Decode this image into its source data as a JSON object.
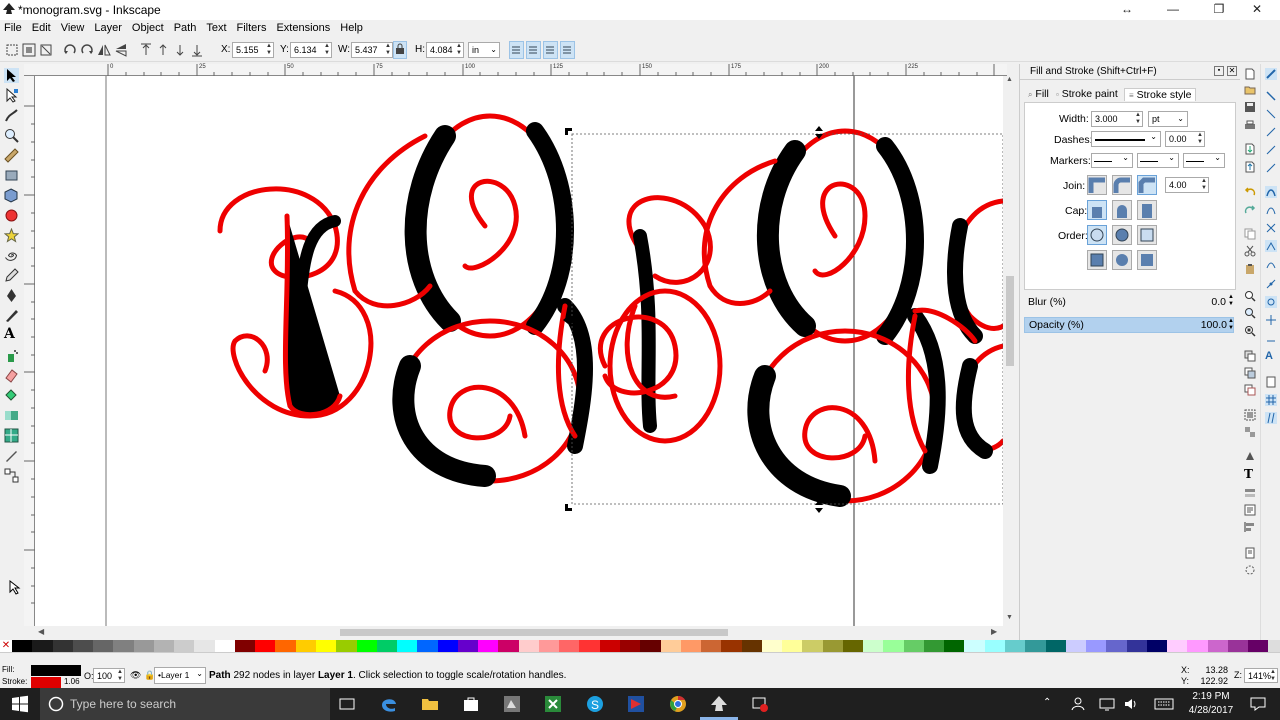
{
  "window": {
    "title": "*monogram.svg - Inkscape",
    "controls": [
      "↔",
      "—",
      "❐",
      "✕"
    ]
  },
  "menu": [
    "File",
    "Edit",
    "View",
    "Layer",
    "Object",
    "Path",
    "Text",
    "Filters",
    "Extensions",
    "Help"
  ],
  "toolcontrols": {
    "x_label": "X:",
    "x_value": "5.155",
    "y_label": "Y:",
    "y_value": "6.134",
    "w_label": "W:",
    "w_value": "5.437",
    "h_label": "H:",
    "h_value": "4.084",
    "unit": "in"
  },
  "ruler": {
    "h_ticks": [
      "0",
      "25",
      "50",
      "75",
      "100",
      "125",
      "150",
      "175",
      "200",
      "225"
    ]
  },
  "panel": {
    "title": "Fill and Stroke (Shift+Ctrl+F)",
    "tabs": [
      "Fill",
      "Stroke paint",
      "Stroke style"
    ],
    "width_label": "Width:",
    "width_value": "3.000",
    "width_unit": "pt",
    "dashes_label": "Dashes:",
    "dashes_value": "0.00",
    "markers_label": "Markers:",
    "join_label": "Join:",
    "join_value": "4.00",
    "cap_label": "Cap:",
    "order_label": "Order:",
    "blur_label": "Blur (%)",
    "blur_value": "0.0",
    "opacity_label": "Opacity (%)",
    "opacity_value": "100.0",
    "opacity_level": 1.0
  },
  "status": {
    "fill_label": "Fill:",
    "stroke_label": "Stroke:",
    "stroke_width": "1.06",
    "opacity_label": "O:",
    "opacity_value": "100",
    "layer": "•Layer 1",
    "message_bold": "Path",
    "message": " 292 nodes in layer ",
    "message_layer": "Layer 1",
    "message_end": ". Click selection to toggle scale/rotation handles.",
    "x_label": "X:",
    "x_value": "13.28",
    "y_label": "Y:",
    "y_value": "122.92",
    "z_label": "Z:",
    "zoom": "141%",
    "colors": {
      "fill": "#000000",
      "stroke": "#e00000"
    }
  },
  "taskbar": {
    "search_placeholder": "Type here to search",
    "time": "2:19 PM",
    "date": "4/28/2017"
  },
  "palette": [
    "#000000",
    "#1a1a1a",
    "#333333",
    "#4d4d4d",
    "#666666",
    "#808080",
    "#999999",
    "#b3b3b3",
    "#cccccc",
    "#e6e6e6",
    "#ffffff",
    "#800000",
    "#ff0000",
    "#ff6600",
    "#ffcc00",
    "#ffff00",
    "#99cc00",
    "#00ff00",
    "#00cc66",
    "#00ffff",
    "#0066ff",
    "#0000ff",
    "#6600cc",
    "#ff00ff",
    "#cc0066",
    "#ffcccc",
    "#ff9999",
    "#ff6666",
    "#ff3333",
    "#cc0000",
    "#990000",
    "#660000",
    "#ffcc99",
    "#ff9966",
    "#cc6633",
    "#993300",
    "#663300",
    "#ffffcc",
    "#ffff99",
    "#cccc66",
    "#999933",
    "#666600",
    "#ccffcc",
    "#99ff99",
    "#66cc66",
    "#339933",
    "#006600",
    "#ccffff",
    "#99ffff",
    "#66cccc",
    "#339999",
    "#006666",
    "#ccccff",
    "#9999ff",
    "#6666cc",
    "#333399",
    "#000066",
    "#ffccff",
    "#ff99ff",
    "#cc66cc",
    "#993399",
    "#660066"
  ]
}
